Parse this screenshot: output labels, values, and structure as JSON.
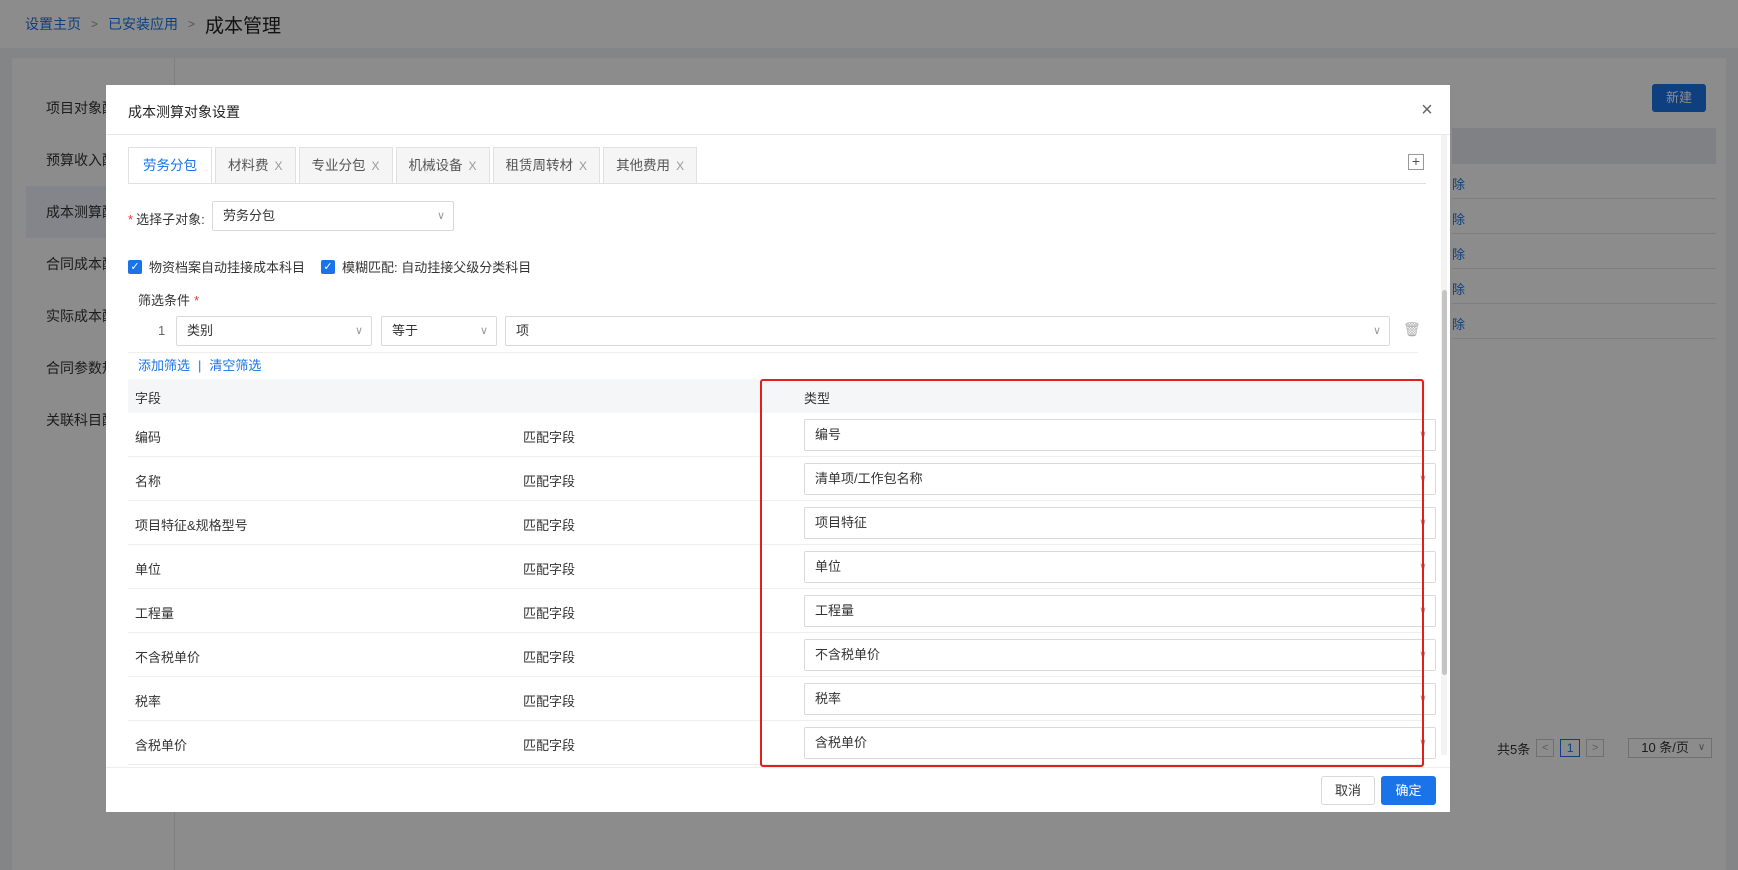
{
  "breadcrumb": {
    "home": "设置主页",
    "installed": "已安装应用",
    "current": "成本管理",
    "separator": ">"
  },
  "background": {
    "sidebar_items": [
      "项目对象配",
      "预算收入配",
      "成本测算配",
      "合同成本配",
      "实际成本配",
      "合同参数规",
      "关联科目配"
    ],
    "new_button": "新建",
    "row_links": [
      "除",
      "除",
      "除",
      "除",
      "除"
    ],
    "pager": {
      "total": "共5条",
      "prev": "<",
      "page": "1",
      "next": ">",
      "page_size": "10 条/页",
      "page_size_caret": "∨"
    }
  },
  "modal": {
    "title": "成本测算对象设置",
    "close_icon": "×",
    "tabs": [
      {
        "label": "劳务分包",
        "closable": false
      },
      {
        "label": "材料费",
        "closable": true
      },
      {
        "label": "专业分包",
        "closable": true
      },
      {
        "label": "机械设备",
        "closable": true
      },
      {
        "label": "租赁周转材",
        "closable": true
      },
      {
        "label": "其他费用",
        "closable": true
      }
    ],
    "tab_close_icon": "X",
    "add_tab_icon": "+",
    "sub_object": {
      "required_mark": "*",
      "label": "选择子对象:",
      "value": "劳务分包"
    },
    "checkboxes": [
      {
        "label": "物资档案自动挂接成本科目",
        "checked": true
      },
      {
        "label": "模糊匹配: 自动挂接父级分类科目",
        "checked": true
      }
    ],
    "checkbox_mark": "✓",
    "filter": {
      "title": "筛选条件",
      "required_mark": "*",
      "index": "1",
      "field": "类别",
      "operator": "等于",
      "value": "项",
      "trash_icon": "🗑",
      "add": "添加筛选",
      "divider": "|",
      "clear": "清空筛选"
    },
    "table": {
      "headers": {
        "field": "字段",
        "type": "类型"
      },
      "rows": [
        {
          "field": "编码",
          "match": "匹配字段",
          "type": "编号"
        },
        {
          "field": "名称",
          "match": "匹配字段",
          "type": "清单项/工作包名称"
        },
        {
          "field": "项目特征&规格型号",
          "match": "匹配字段",
          "type": "项目特征"
        },
        {
          "field": "单位",
          "match": "匹配字段",
          "type": "单位"
        },
        {
          "field": "工程量",
          "match": "匹配字段",
          "type": "工程量"
        },
        {
          "field": "不含税单价",
          "match": "匹配字段",
          "type": "不含税单价"
        },
        {
          "field": "税率",
          "match": "匹配字段",
          "type": "税率"
        },
        {
          "field": "含税单价",
          "match": "匹配字段",
          "type": "含税单价"
        }
      ]
    },
    "caret": "∨",
    "buttons": {
      "cancel": "取消",
      "ok": "确定"
    }
  },
  "colors": {
    "accent": "#1a73e8",
    "highlight_border": "#e0201c",
    "required": "#e53935"
  }
}
